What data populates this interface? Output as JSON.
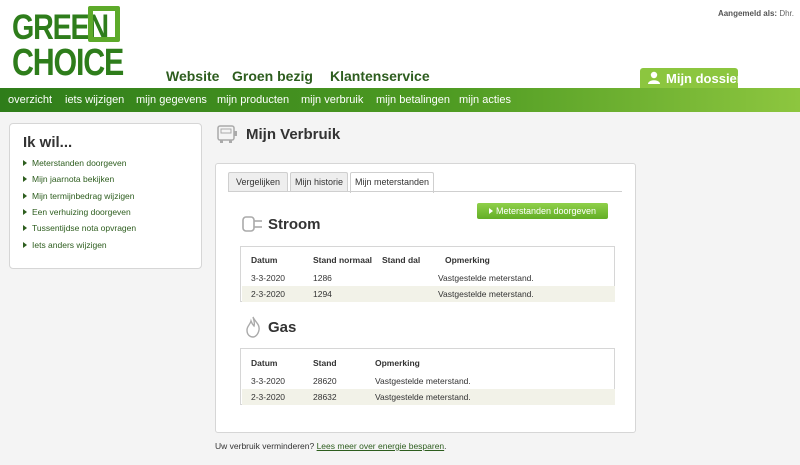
{
  "logo": {
    "line1": "GREEN",
    "line2": "CHOICE"
  },
  "header": {
    "logged_in_label": "Aangemeld als:",
    "logged_in_user": "Dhr."
  },
  "top_nav": [
    "Website",
    "Groen bezig",
    "Klantenservice"
  ],
  "dossier_tab": {
    "label": "Mijn dossier",
    "icon": "user-icon"
  },
  "green_nav": [
    "overzicht",
    "iets wijzigen",
    "mijn gegevens",
    "mijn producten",
    "mijn verbruik",
    "mijn betalingen",
    "mijn acties"
  ],
  "sidebar": {
    "title": "Ik wil...",
    "items": [
      "Meterstanden doorgeven",
      "Mijn jaarnota bekijken",
      "Mijn termijnbedrag wijzigen",
      "Een verhuizing doorgeven",
      "Tussentijdse nota opvragen",
      "Iets anders wijzigen"
    ]
  },
  "page": {
    "title": "Mijn Verbruik",
    "icon": "meter-icon"
  },
  "tabs": [
    "Vergelijken",
    "Mijn historie",
    "Mijn meterstanden"
  ],
  "active_tab": "Mijn meterstanden",
  "submit_button": "Meterstanden doorgeven",
  "stroom": {
    "title": "Stroom",
    "icon": "plug-icon",
    "headers": [
      "Datum",
      "Stand normaal",
      "Stand dal",
      "Opmerking"
    ],
    "rows": [
      {
        "datum": "3-3-2020",
        "normaal": "1286",
        "dal": "",
        "opmerking": "Vastgestelde meterstand."
      },
      {
        "datum": "2-3-2020",
        "normaal": "1294",
        "dal": "",
        "opmerking": "Vastgestelde meterstand."
      }
    ]
  },
  "gas": {
    "title": "Gas",
    "icon": "flame-icon",
    "headers": [
      "Datum",
      "Stand",
      "Opmerking"
    ],
    "rows": [
      {
        "datum": "3-3-2020",
        "stand": "28620",
        "opmerking": "Vastgestelde meterstand."
      },
      {
        "datum": "2-3-2020",
        "stand": "28632",
        "opmerking": "Vastgestelde meterstand."
      }
    ]
  },
  "footer": {
    "text": "Uw verbruik verminderen?",
    "link": "Lees meer over energie besparen",
    "suffix": "."
  },
  "colors": {
    "brand_dark": "#2e7d1b",
    "brand_light": "#8cc63f",
    "link": "#2d5d1e"
  }
}
